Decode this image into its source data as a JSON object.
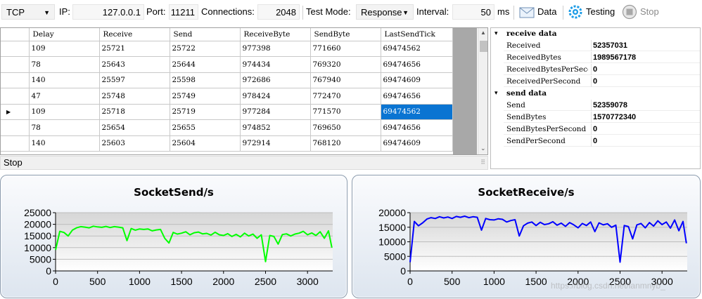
{
  "toolbar": {
    "protocol": "TCP",
    "ip_label": "IP:",
    "ip_value": "127.0.0.1",
    "port_label": "Port:",
    "port_value": "11211",
    "connections_label": "Connections:",
    "connections_value": "2048",
    "test_mode_label": "Test Mode:",
    "test_mode_value": "Response",
    "interval_label": "Interval:",
    "interval_value": "50",
    "interval_unit": "ms",
    "data_button": "Data",
    "testing_button": "Testing",
    "stop_button": "Stop"
  },
  "grid": {
    "columns": [
      "Delay",
      "Receive",
      "Send",
      "ReceiveByte",
      "SendByte",
      "LastSendTick"
    ],
    "rows": [
      [
        "109",
        "25721",
        "25722",
        "977398",
        "771660",
        "69474562"
      ],
      [
        "78",
        "25643",
        "25644",
        "974434",
        "769320",
        "69474656"
      ],
      [
        "140",
        "25597",
        "25598",
        "972686",
        "767940",
        "69474609"
      ],
      [
        "47",
        "25748",
        "25749",
        "978424",
        "772470",
        "69474656"
      ],
      [
        "109",
        "25718",
        "25719",
        "977284",
        "771570",
        "69474562"
      ],
      [
        "78",
        "25654",
        "25655",
        "974852",
        "769650",
        "69474656"
      ],
      [
        "140",
        "25603",
        "25604",
        "972914",
        "768120",
        "69474609"
      ]
    ],
    "current_row": 4
  },
  "status": {
    "text": "Stop"
  },
  "properties": {
    "receive": {
      "header": "receive data",
      "items": [
        {
          "key": "Received",
          "value": "52357031"
        },
        {
          "key": "ReceivedBytes",
          "value": "1989567178"
        },
        {
          "key": "ReceivedBytesPerSecond",
          "value": "0"
        },
        {
          "key": "ReceivedPerSecond",
          "value": "0"
        }
      ]
    },
    "send": {
      "header": "send data",
      "items": [
        {
          "key": "Send",
          "value": "52359078"
        },
        {
          "key": "SendBytes",
          "value": "1570772340"
        },
        {
          "key": "SendBytesPerSecond",
          "value": "0"
        },
        {
          "key": "SendPerSecond",
          "value": "0"
        }
      ]
    }
  },
  "charts": {
    "send": {
      "title": "SocketSend/s"
    },
    "receive": {
      "title": "SocketReceive/s"
    }
  },
  "watermark": "https://blog.csdn.net/lanmnyb_",
  "colors": {
    "send": "#00ff00",
    "receive": "#0000ff",
    "selection": "#0a74d2"
  },
  "chart_data": [
    {
      "type": "line",
      "title": "SocketSend/s",
      "xlabel": "",
      "ylabel": "",
      "xlim": [
        0,
        3300
      ],
      "ylim": [
        0,
        25000
      ],
      "xticks": [
        0,
        500,
        1000,
        1500,
        2000,
        2500,
        3000
      ],
      "yticks": [
        0,
        5000,
        10000,
        15000,
        20000,
        25000
      ],
      "grid": true,
      "series": [
        {
          "color": "#00ff00",
          "x": [
            0,
            50,
            100,
            150,
            200,
            250,
            300,
            350,
            400,
            450,
            500,
            550,
            600,
            650,
            700,
            750,
            800,
            850,
            900,
            950,
            1000,
            1050,
            1100,
            1150,
            1200,
            1250,
            1300,
            1350,
            1400,
            1450,
            1500,
            1550,
            1600,
            1650,
            1700,
            1750,
            1800,
            1850,
            1900,
            1950,
            2000,
            2050,
            2100,
            2150,
            2200,
            2250,
            2300,
            2350,
            2400,
            2450,
            2500,
            2550,
            2600,
            2650,
            2700,
            2750,
            2800,
            2850,
            2900,
            2950,
            3000,
            3050,
            3100,
            3150,
            3200,
            3250,
            3290
          ],
          "y": [
            9000,
            17000,
            16500,
            15000,
            17500,
            18500,
            19000,
            18800,
            18500,
            19200,
            18900,
            18700,
            19100,
            18600,
            19000,
            18800,
            18500,
            13000,
            18200,
            17500,
            18000,
            17800,
            18000,
            17200,
            17600,
            17800,
            14000,
            12000,
            16500,
            15800,
            16200,
            16800,
            15500,
            16400,
            16700,
            15900,
            16100,
            15400,
            16600,
            15500,
            15200,
            16000,
            14800,
            15700,
            14600,
            16200,
            15000,
            15800,
            14000,
            15500,
            4000,
            15200,
            14800,
            11500,
            15600,
            15900,
            15000,
            15800,
            16200,
            17000,
            15500,
            16300,
            15200,
            16800,
            14000,
            17200,
            10000
          ]
        }
      ]
    },
    {
      "type": "line",
      "title": "SocketReceive/s",
      "xlabel": "",
      "ylabel": "",
      "xlim": [
        0,
        3300
      ],
      "ylim": [
        0,
        20000
      ],
      "xticks": [
        0,
        500,
        1000,
        1500,
        2000,
        2500,
        3000
      ],
      "yticks": [
        0,
        5000,
        10000,
        15000,
        20000
      ],
      "grid": true,
      "series": [
        {
          "color": "#0000ff",
          "x": [
            0,
            50,
            100,
            150,
            200,
            250,
            300,
            350,
            400,
            450,
            500,
            550,
            600,
            650,
            700,
            750,
            800,
            850,
            900,
            950,
            1000,
            1050,
            1100,
            1150,
            1200,
            1250,
            1300,
            1350,
            1400,
            1450,
            1500,
            1550,
            1600,
            1650,
            1700,
            1750,
            1800,
            1850,
            1900,
            1950,
            2000,
            2050,
            2100,
            2150,
            2200,
            2250,
            2300,
            2350,
            2400,
            2450,
            2500,
            2550,
            2600,
            2650,
            2700,
            2750,
            2800,
            2850,
            2900,
            2950,
            3000,
            3050,
            3100,
            3150,
            3200,
            3250,
            3290
          ],
          "y": [
            3000,
            17000,
            15500,
            16500,
            17800,
            18300,
            18000,
            18600,
            18200,
            18500,
            18000,
            18700,
            18400,
            18800,
            18300,
            18600,
            18400,
            14000,
            18000,
            17600,
            17500,
            17900,
            17700,
            16800,
            17300,
            17600,
            12000,
            15500,
            16400,
            16800,
            15600,
            16700,
            15900,
            16200,
            16900,
            15700,
            16400,
            15300,
            16600,
            15800,
            14800,
            16300,
            15600,
            16800,
            13500,
            16500,
            15800,
            16200,
            15000,
            15700,
            3000,
            15600,
            15200,
            11000,
            15800,
            16300,
            14800,
            16600,
            15400,
            17200,
            15900,
            16800,
            14700,
            17500,
            13800,
            17000,
            9500
          ]
        }
      ]
    }
  ]
}
